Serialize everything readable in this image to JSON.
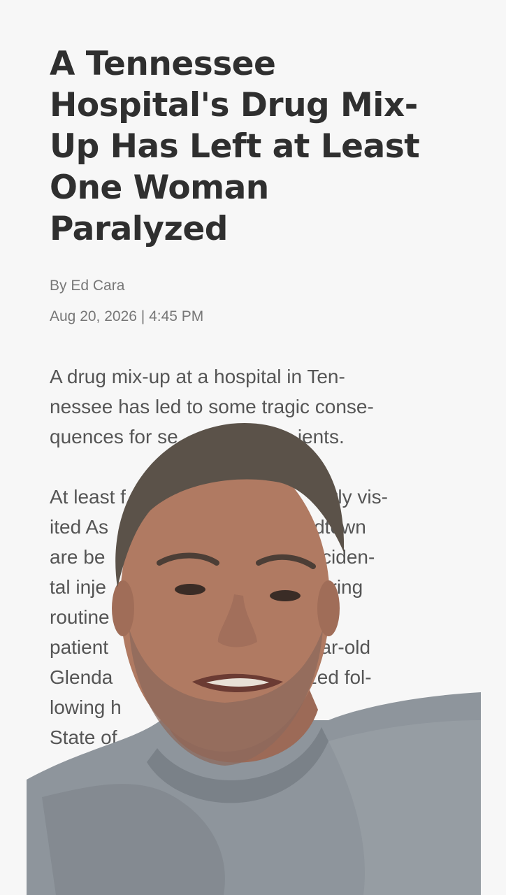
{
  "article": {
    "headline": "A Tennessee Hospital's Drug Mix-Up Has Left at Least One Woman Paralyzed",
    "byline": "By Ed Cara",
    "dateline": "Aug 20, 2026 | 4:45 PM",
    "paragraph1_lines": [
      "A drug mix-up at a hospital in Ten-",
      "nessee has led to some tragic conse-",
      "quences for se                      ients."
    ],
    "paragraph2_lines": [
      "At least f                                  ently vis-",
      "ited As                                  Midtown",
      "are be                                 d acciden-",
      "tal inje                               rug during",
      "routine                                these",
      "patient                              72-year-old",
      "Glenda                              ralyzed fol-",
      "lowing h",
      "State of"
    ]
  },
  "overlay": {
    "description_icon": "person-video-overlay",
    "shirt_color": "#8e959c",
    "skin_color": "#b07a62",
    "hair_color": "#5b5249"
  }
}
